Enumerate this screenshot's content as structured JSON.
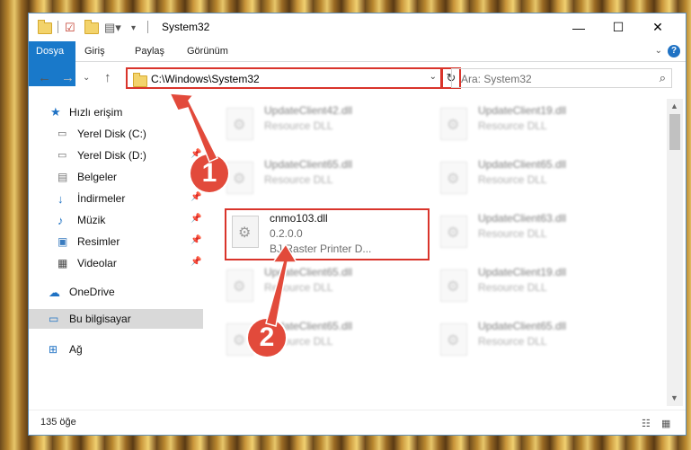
{
  "window": {
    "title": "System32",
    "controls": {
      "minimize": "—",
      "maximize": "☐",
      "close": "✕"
    }
  },
  "ribbon": {
    "tabs": [
      "Dosya",
      "Giriş",
      "Paylaş",
      "Görünüm"
    ],
    "help": "?"
  },
  "nav": {
    "address": "C:\\Windows\\System32",
    "search_placeholder": "Ara: System32"
  },
  "sidebar": {
    "quick_access": "Hızlı erişim",
    "items": [
      {
        "label": "Yerel Disk (C:)",
        "icon": "drive-icon",
        "pinned": false
      },
      {
        "label": "Yerel Disk (D:)",
        "icon": "drive-icon",
        "pinned": true
      },
      {
        "label": "Belgeler",
        "icon": "documents-icon",
        "pinned": true
      },
      {
        "label": "İndirmeler",
        "icon": "download-icon",
        "pinned": true
      },
      {
        "label": "Müzik",
        "icon": "music-icon",
        "pinned": true
      },
      {
        "label": "Resimler",
        "icon": "pictures-icon",
        "pinned": true
      },
      {
        "label": "Videolar",
        "icon": "video-icon",
        "pinned": true
      }
    ],
    "onedrive": "OneDrive",
    "this_pc": "Bu bilgisayar",
    "network": "Ağ"
  },
  "files": {
    "left": [
      {
        "name": "UpdateClient42.dll",
        "desc": "Resource DLL"
      },
      {
        "name": "UpdateClient65.dll",
        "desc": "Resource DLL"
      },
      {
        "name": "cnmo103.dll",
        "version": "0.2.0.0",
        "desc": "BJ Raster Printer D..."
      },
      {
        "name": "UpdateClient65.dll",
        "desc": "Resource DLL"
      },
      {
        "name": "UpdateClient65.dll",
        "desc": "Resource DLL"
      }
    ],
    "right": [
      {
        "name": "UpdateClient19.dll",
        "desc": "Resource DLL"
      },
      {
        "name": "UpdateClient65.dll",
        "desc": "Resource DLL"
      },
      {
        "name": "UpdateClient63.dll",
        "desc": "Resource DLL"
      },
      {
        "name": "UpdateClient19.dll",
        "desc": "Resource DLL"
      },
      {
        "name": "UpdateClient65.dll",
        "desc": "Resource DLL"
      }
    ]
  },
  "status": {
    "count": "135 öğe"
  },
  "callouts": [
    "1",
    "2"
  ],
  "colors": {
    "accent": "#1979ca",
    "highlight": "#d9342b",
    "callout": "#e24a3b"
  }
}
